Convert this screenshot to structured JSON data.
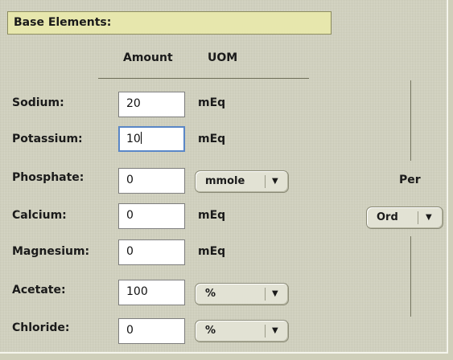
{
  "section": {
    "title": "Base Elements:"
  },
  "columns": {
    "amount": "Amount",
    "uom": "UOM"
  },
  "rows": [
    {
      "label": "Sodium:",
      "value": "20",
      "uom": "mEq"
    },
    {
      "label": "Potassium:",
      "value": "10",
      "uom": "mEq"
    },
    {
      "label": "Phosphate:",
      "value": "0",
      "uom": "mmole"
    },
    {
      "label": "Calcium:",
      "value": "0",
      "uom": "mEq"
    },
    {
      "label": "Magnesium:",
      "value": "0",
      "uom": "mEq"
    },
    {
      "label": "Acetate:",
      "value": "100",
      "uom": "%"
    },
    {
      "label": "Chloride:",
      "value": "0",
      "uom": "%"
    }
  ],
  "per": {
    "label": "Per",
    "selected": "Ord"
  },
  "colors": {
    "header_bg": "#e7e7ad",
    "panel_bg": "#d2d2bf",
    "focus_border": "#5a87c7"
  },
  "icons": {
    "dropdown": "triangle-down-icon"
  }
}
